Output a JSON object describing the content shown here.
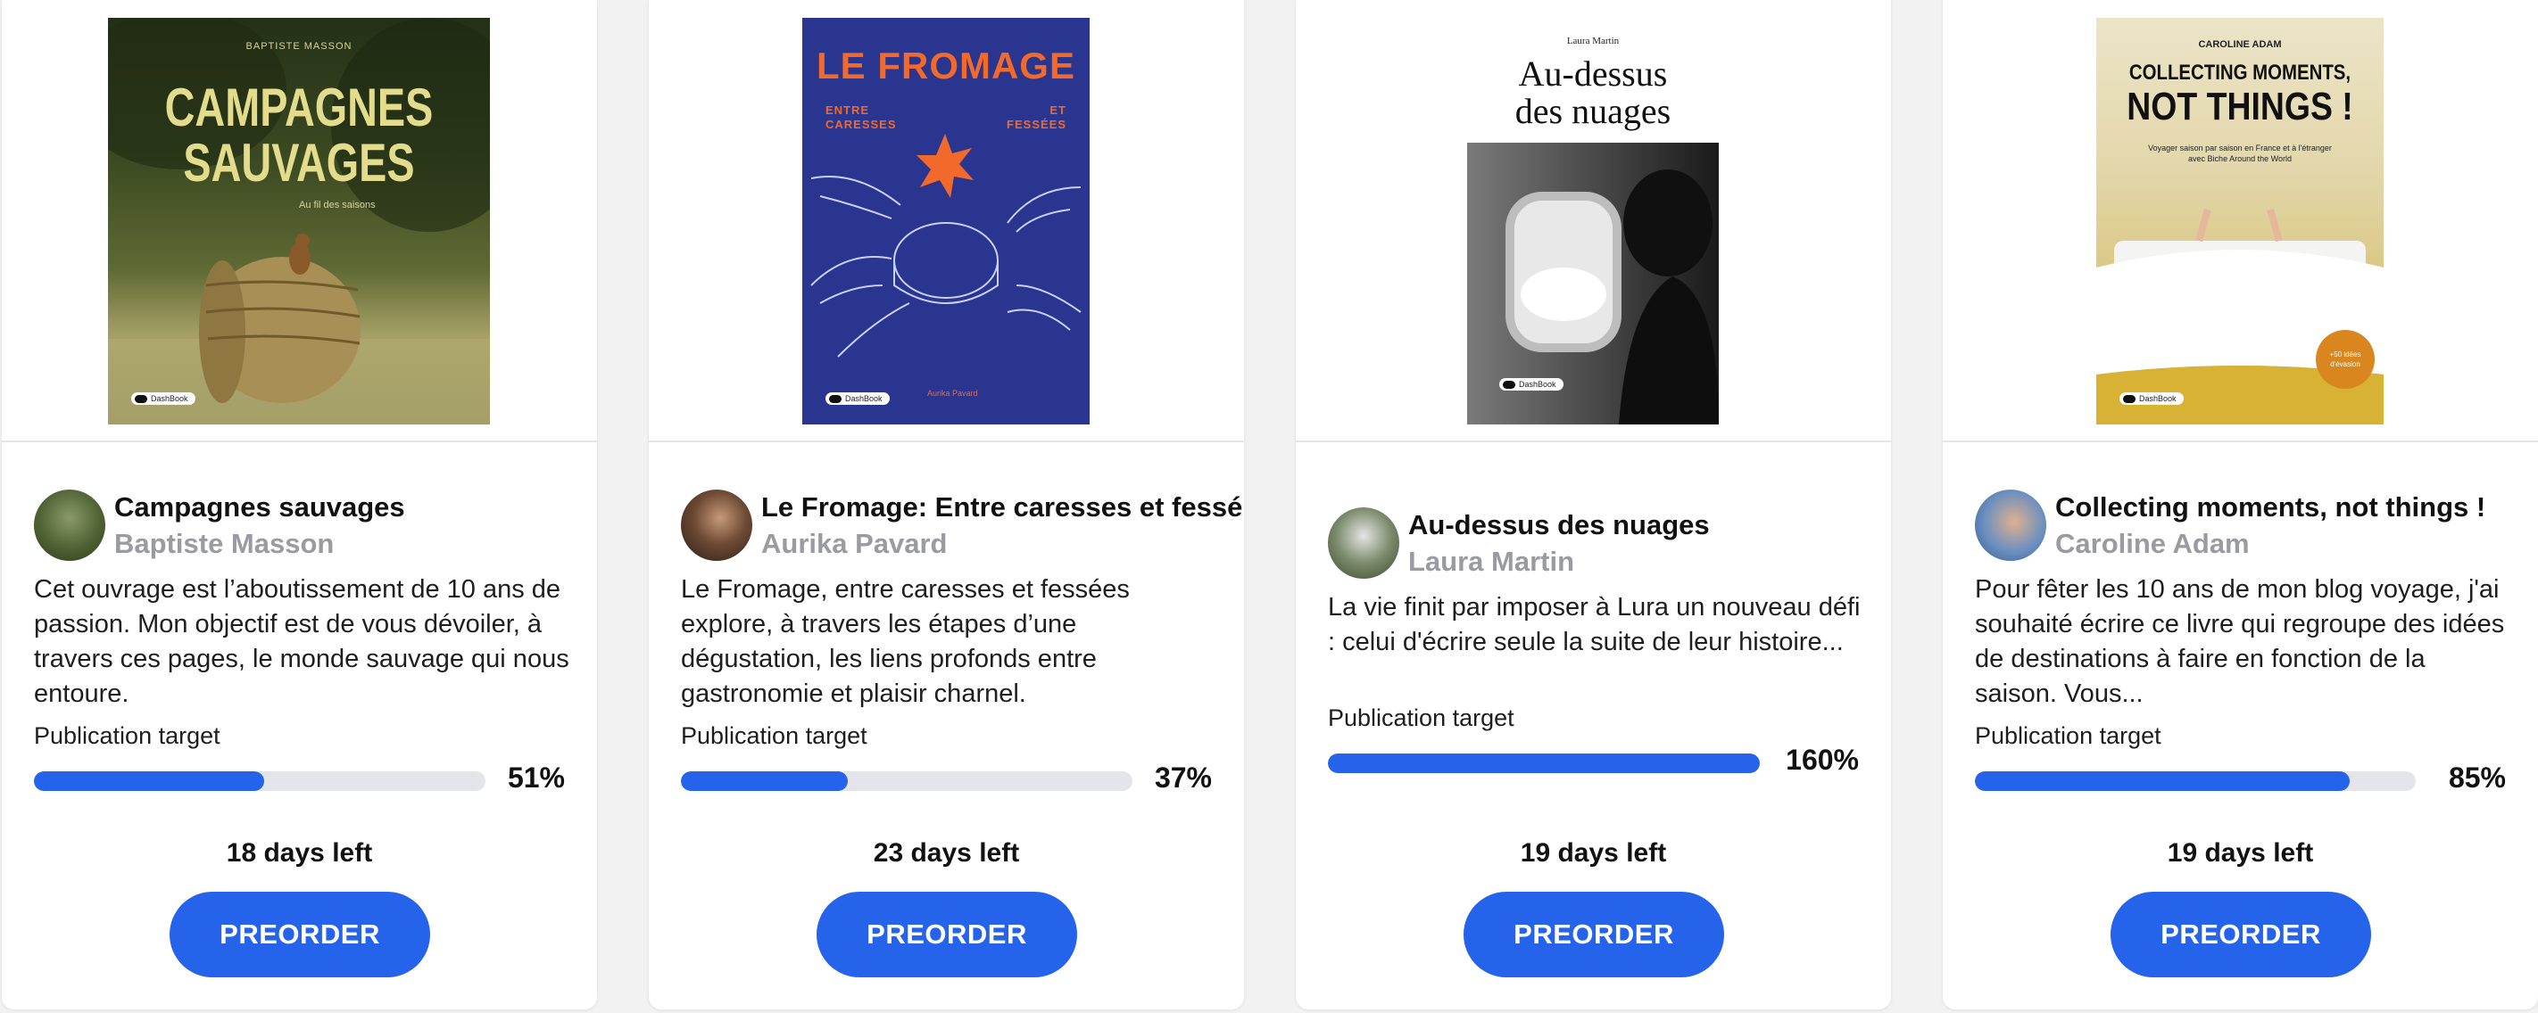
{
  "colors": {
    "accent": "#2563eb",
    "track": "#e4e5ea",
    "author": "#9a9aa2"
  },
  "cards": [
    {
      "title": "Campagnes sauvages",
      "author": "Baptiste Masson",
      "description": "Cet ouvrage est l’aboutissement de 10 ans de passion. Mon objectif est de vous dévoiler, à travers ces pages, le monde sauvage qui nous entoure.",
      "target_label": "Publication target",
      "percent": "51%",
      "progress": 0.51,
      "days_left": "18 days left",
      "button": "PREORDER",
      "cover": {
        "author": "BAPTISTE MASSON",
        "title_line1": "CAMPAGNES",
        "title_line2": "SAUVAGES",
        "subtitle": "Au fil des saisons",
        "brand": "DashBook"
      }
    },
    {
      "title": "Le Fromage: Entre caresses et fessé",
      "author": "Aurika Pavard",
      "description": "Le Fromage, entre caresses et fessées explore, à travers les étapes d’une dégustation, les liens profonds entre gastronomie et plaisir charnel.",
      "target_label": "Publication target",
      "percent": "37%",
      "progress": 0.37,
      "days_left": "23 days left",
      "button": "PREORDER",
      "cover": {
        "title": "LE FROMAGE",
        "sub_left": "ENTRE CARESSES",
        "sub_right": "ET FESSÉES",
        "author": "Aurika Pavard",
        "brand": "DashBook"
      }
    },
    {
      "title": "Au-dessus des nuages",
      "author": "Laura Martin",
      "description": "La vie finit par imposer à Lura un nouveau défi : celui d'écrire seule la suite de leur histoire...",
      "target_label": "Publication target",
      "percent": "160%",
      "progress": 1.0,
      "days_left": "19 days left",
      "button": "PREORDER",
      "cover": {
        "author": "Laura Martin",
        "title_line1": "Au-dessus",
        "title_line2": "des nuages",
        "brand": "DashBook"
      }
    },
    {
      "title": "Collecting moments, not things !",
      "author": "Caroline Adam",
      "description": "Pour fêter les 10 ans de mon blog voyage, j'ai souhaité écrire ce livre qui regroupe des idées de destinations à faire en fonction de la saison. Vous...",
      "target_label": "Publication target",
      "percent": "85%",
      "progress": 0.85,
      "days_left": "19 days left",
      "button": "PREORDER",
      "cover": {
        "author": "CAROLINE ADAM",
        "title_line1": "COLLECTING MOMENTS,",
        "title_line2": "NOT THINGS !",
        "subtitle_line1": "Voyager saison par saison en France et à l'étranger",
        "subtitle_line2": "avec Biche Around the World",
        "badge_line1": "+50 idées",
        "badge_line2": "d'évasion",
        "brand": "DashBook"
      }
    }
  ]
}
